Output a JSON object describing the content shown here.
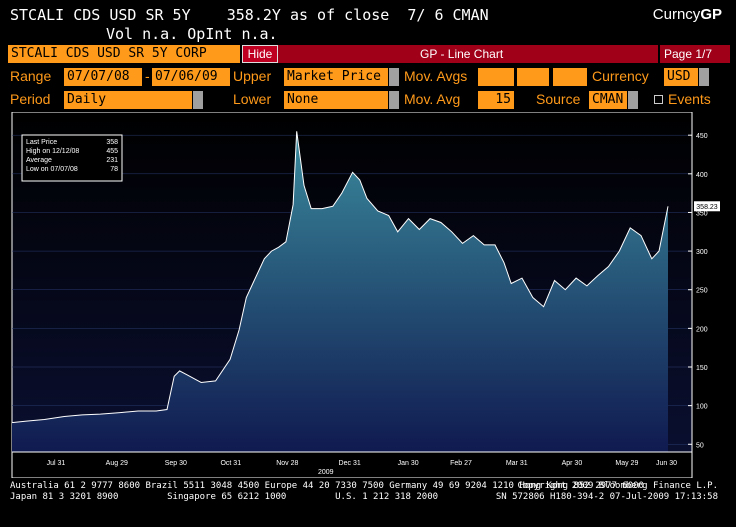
{
  "header": {
    "ticker_line": "STCALI CDS USD SR 5Y    358.2Y as of close  7/ 6 CMAN",
    "vol_line": "Vol n.a. OpInt n.a.",
    "brand_prefix": "Curncy",
    "brand_suffix": "GP"
  },
  "security_field": "STCALI CDS USD SR 5Y CORP",
  "hide_label": "Hide",
  "bar_title": "GP - Line Chart",
  "page_indicator": "Page 1/7",
  "controls": {
    "range_label": "Range",
    "range_start": "07/07/08",
    "range_dash": "-",
    "range_end": "07/06/09",
    "upper_label": "Upper",
    "upper_value": "Market Price",
    "movavgs_label": "Mov. Avgs",
    "currency_label": "Currency",
    "currency_value": "USD",
    "period_label": "Period",
    "period_value": "Daily",
    "lower_label": "Lower",
    "lower_value": "None",
    "movavg_label": "Mov. Avg",
    "movavg_value": "15",
    "source_label": "Source",
    "source_value": "CMAN",
    "events_label": "Events"
  },
  "legend_box": {
    "rows": [
      {
        "label": "Last Price",
        "value": "358"
      },
      {
        "label": "High on 12/12/08",
        "value": "455"
      },
      {
        "label": "Average",
        "value": "231"
      },
      {
        "label": "Low on 07/07/08",
        "value": "78"
      }
    ]
  },
  "last_price_tag": "358.23",
  "footer_left": "Australia 61 2 9777 8600 Brazil 5511 3048 4500 Europe 44 20 7330 7500 Germany 49 69 9204 1210 Hong Kong 852 2977 6000\nJapan 81 3 3201 8900         Singapore 65 6212 1000         U.S. 1 212 318 2000",
  "footer_right": "Copyright 2009 Bloomberg Finance L.P.\nSN 572806 H180-394-2 07-Jul-2009 17:13:58",
  "colors": {
    "orange": "#ff9a1a",
    "red_bar": "#a00018",
    "area_top": "#3a8a9c",
    "area_bottom": "#101a50",
    "line": "#ffffff"
  },
  "chart_data": {
    "type": "area",
    "ylim": [
      40,
      480
    ],
    "y_ticks": [
      50,
      100,
      150,
      200,
      250,
      300,
      350,
      400,
      450
    ],
    "x_tick_labels": [
      "Jul 31",
      "Aug 29",
      "Sep 30",
      "Oct 31",
      "Nov 28",
      "Dec 31",
      "Jan 30",
      "Feb 27",
      "Mar 31",
      "Apr 30",
      "May 29",
      "Jun 30"
    ],
    "year_label": "2009",
    "x": [
      "2008-07-07",
      "2008-07-15",
      "2008-07-25",
      "2008-08-05",
      "2008-08-15",
      "2008-08-25",
      "2008-09-05",
      "2008-09-15",
      "2008-09-25",
      "2008-10-01",
      "2008-10-05",
      "2008-10-08",
      "2008-10-12",
      "2008-10-20",
      "2008-10-28",
      "2008-11-05",
      "2008-11-10",
      "2008-11-14",
      "2008-11-18",
      "2008-11-24",
      "2008-11-28",
      "2008-12-02",
      "2008-12-06",
      "2008-12-10",
      "2008-12-12",
      "2008-12-16",
      "2008-12-20",
      "2008-12-26",
      "2009-01-01",
      "2009-01-06",
      "2009-01-12",
      "2009-01-16",
      "2009-01-20",
      "2009-01-26",
      "2009-02-01",
      "2009-02-06",
      "2009-02-12",
      "2009-02-18",
      "2009-02-24",
      "2009-03-02",
      "2009-03-08",
      "2009-03-14",
      "2009-03-20",
      "2009-03-26",
      "2009-04-01",
      "2009-04-06",
      "2009-04-10",
      "2009-04-16",
      "2009-04-22",
      "2009-04-28",
      "2009-05-04",
      "2009-05-10",
      "2009-05-16",
      "2009-05-22",
      "2009-05-28",
      "2009-06-03",
      "2009-06-09",
      "2009-06-15",
      "2009-06-21",
      "2009-06-27",
      "2009-07-01",
      "2009-07-06"
    ],
    "values": [
      78,
      80,
      82,
      86,
      88,
      89,
      91,
      93,
      93,
      95,
      138,
      145,
      140,
      130,
      132,
      160,
      198,
      240,
      260,
      290,
      300,
      305,
      312,
      360,
      455,
      385,
      355,
      355,
      358,
      375,
      402,
      392,
      368,
      352,
      346,
      325,
      342,
      328,
      342,
      337,
      325,
      310,
      320,
      308,
      308,
      285,
      258,
      265,
      240,
      228,
      262,
      250,
      265,
      255,
      268,
      280,
      300,
      330,
      320,
      290,
      300,
      358
    ]
  }
}
